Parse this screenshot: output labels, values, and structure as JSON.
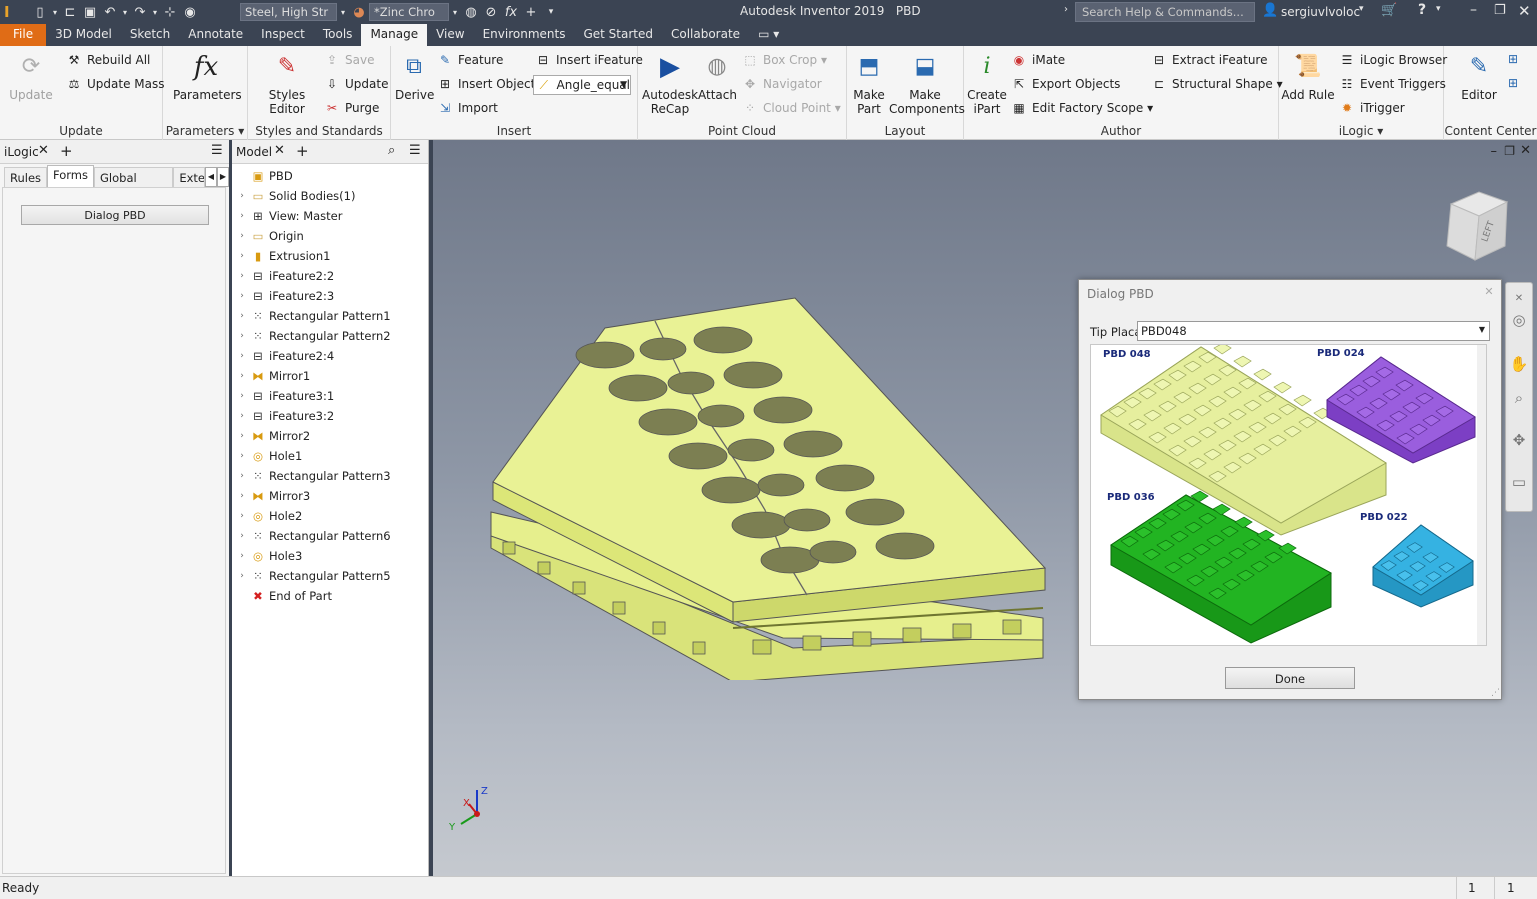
{
  "app": {
    "title": "Autodesk Inventor 2019",
    "document": "PBD",
    "search_placeholder": "Search Help & Commands...",
    "user": "sergiuvlvoloc"
  },
  "quick_access": {
    "material": "Steel, High Str",
    "appearance": "*Zinc Chro"
  },
  "menu": [
    "File",
    "3D Model",
    "Sketch",
    "Annotate",
    "Inspect",
    "Tools",
    "Manage",
    "View",
    "Environments",
    "Get Started",
    "Collaborate"
  ],
  "ribbon": {
    "update": {
      "update": "Update",
      "rebuild_all": "Rebuild All",
      "update_mass": "Update Mass",
      "title": "Update"
    },
    "parameters": {
      "label": "Parameters",
      "title": "Parameters"
    },
    "styles": {
      "styles_editor": "Styles Editor",
      "save": "Save",
      "update": "Update",
      "purge": "Purge",
      "title": "Styles and Standards"
    },
    "insert": {
      "derive": "Derive",
      "feature": "Feature",
      "insert_object": "Insert Object",
      "import": "Import",
      "insert_ifeature": "Insert iFeature",
      "angle": "Angle_equal",
      "title": "Insert"
    },
    "point_cloud": {
      "recap_1": "Autodesk",
      "recap_2": "ReCap",
      "attach": "Attach",
      "box_crop": "Box Crop",
      "navigator": "Navigator",
      "cloud_point": "Cloud Point",
      "title": "Point Cloud"
    },
    "layout": {
      "make_part_1": "Make",
      "make_part_2": "Part",
      "make_comp_1": "Make",
      "make_comp_2": "Components",
      "title": "Layout"
    },
    "author": {
      "create_1": "Create",
      "create_2": "iPart",
      "imate": "iMate",
      "export_objects": "Export Objects",
      "edit_factory": "Edit Factory Scope",
      "extract": "Extract iFeature",
      "structural": "Structural Shape",
      "title": "Author"
    },
    "ilogic": {
      "add_rule": "Add Rule",
      "browser": "iLogic Browser",
      "triggers": "Event Triggers",
      "itrigger": "iTrigger",
      "title": "iLogic"
    },
    "content": {
      "editor": "Editor",
      "title": "Content Center"
    }
  },
  "ilogic_panel": {
    "title": "iLogic",
    "tabs": [
      "Rules",
      "Forms",
      "Global Forms",
      "Extern"
    ],
    "form_button": "Dialog PBD"
  },
  "model_panel": {
    "title": "Model",
    "items": [
      {
        "label": "PBD",
        "icon": "part-icon"
      },
      {
        "label": "Solid Bodies(1)",
        "icon": "folder-icon"
      },
      {
        "label": "View: Master",
        "icon": "view-icon"
      },
      {
        "label": "Origin",
        "icon": "folder-icon"
      },
      {
        "label": "Extrusion1",
        "icon": "extrusion-icon"
      },
      {
        "label": "iFeature2:2",
        "icon": "ifeature-icon"
      },
      {
        "label": "iFeature2:3",
        "icon": "ifeature-icon"
      },
      {
        "label": "Rectangular Pattern1",
        "icon": "pattern-icon"
      },
      {
        "label": "Rectangular Pattern2",
        "icon": "pattern-icon"
      },
      {
        "label": "iFeature2:4",
        "icon": "ifeature-icon"
      },
      {
        "label": "Mirror1",
        "icon": "mirror-icon"
      },
      {
        "label": "iFeature3:1",
        "icon": "ifeature-icon"
      },
      {
        "label": "iFeature3:2",
        "icon": "ifeature-icon"
      },
      {
        "label": "Mirror2",
        "icon": "mirror-icon"
      },
      {
        "label": "Hole1",
        "icon": "hole-icon"
      },
      {
        "label": "Rectangular Pattern3",
        "icon": "pattern-icon"
      },
      {
        "label": "Mirror3",
        "icon": "mirror-icon"
      },
      {
        "label": "Hole2",
        "icon": "hole-icon"
      },
      {
        "label": "Rectangular Pattern6",
        "icon": "pattern-icon"
      },
      {
        "label": "Hole3",
        "icon": "hole-icon"
      },
      {
        "label": "Rectangular Pattern5",
        "icon": "pattern-icon"
      },
      {
        "label": "End of Part",
        "icon": "end-of-part-icon"
      }
    ]
  },
  "viewcube": {
    "face": "LEFT"
  },
  "triad": {
    "x": "X",
    "y": "Y",
    "z": "Z"
  },
  "dialog": {
    "title": "Dialog PBD",
    "field_label": "Tip Placa",
    "field_value": "PBD048",
    "preview_labels": [
      "PBD 048",
      "PBD 024",
      "PBD 036",
      "PBD 022"
    ],
    "done": "Done"
  },
  "status": {
    "text": "Ready",
    "count1": "1",
    "count2": "1"
  },
  "colors": {
    "title_bg": "#3b4453",
    "file_tab": "#e06c16",
    "part": "#e6f28e",
    "pbd048": "#dfe99a",
    "pbd024": "#8a4fd0",
    "pbd036": "#1fae1f",
    "pbd022": "#2fa8d8"
  }
}
